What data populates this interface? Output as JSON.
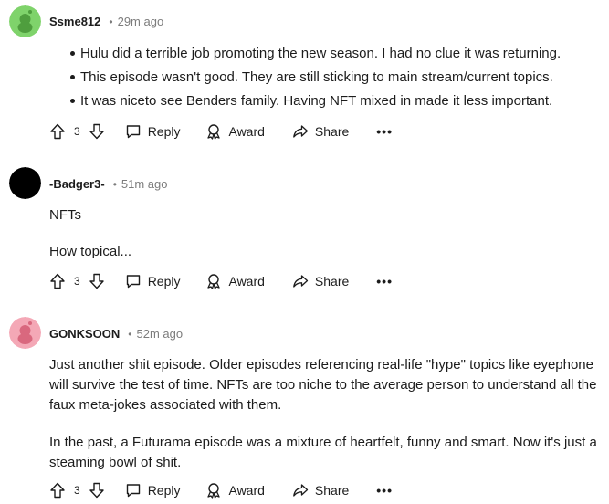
{
  "comments": [
    {
      "author": "Ssme812",
      "time": "29m ago",
      "avatar_color": "#7fd36b",
      "bullets": [
        "Hulu did a terrible job promoting the new season. I had no clue it was returning.",
        "This episode wasn't good. They are still sticking to main stream/current topics.",
        "It was niceto see Benders family. Having NFT mixed in made it less important."
      ],
      "votes": "3",
      "reply_label": "Reply",
      "award_label": "Award",
      "share_label": "Share"
    },
    {
      "author": "-Badger3-",
      "time": "51m ago",
      "avatar_color": "#000000",
      "paragraphs": [
        "NFTs",
        "How topical..."
      ],
      "votes": "3",
      "reply_label": "Reply",
      "award_label": "Award",
      "share_label": "Share"
    },
    {
      "author": "GONKSOON",
      "time": "52m ago",
      "avatar_color": "#f4a8b6",
      "paragraphs": [
        "Just another shit episode. Older episodes referencing real-life \"hype\" topics like eyephone will survive the test of time. NFTs are too niche to the average person to understand all the faux meta-jokes associated with them.",
        "In the past, a Futurama episode was a mixture of heartfelt, funny and smart. Now it's just a steaming bowl of shit."
      ],
      "votes": "3",
      "reply_label": "Reply",
      "award_label": "Award",
      "share_label": "Share"
    }
  ],
  "separator": "•",
  "more_label": "•••"
}
